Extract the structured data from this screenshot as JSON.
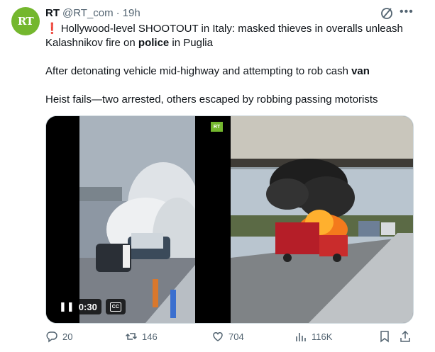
{
  "tweet": {
    "avatar_text": "RT",
    "name": "RT",
    "handle": "@RT_com",
    "separator": "·",
    "time": "19h",
    "line1_pre": "Hollywood-level SHOOTOUT in Italy: masked thieves in overalls unleash",
    "line2_pre": "Kalashnikov fire on ",
    "line2_bold": "police",
    "line2_post": " in Puglia",
    "line3_pre": "After detonating vehicle mid-highway and attempting to rob cash ",
    "line3_bold": "van",
    "line4": "Heist fails—two arrested, others escaped by robbing passing motorists"
  },
  "media": {
    "video_time": "0:30",
    "video_badge": "RT",
    "cc_label": "CC"
  },
  "actions": {
    "replies": "20",
    "reposts": "146",
    "likes": "704",
    "views": "116K"
  },
  "icons": [
    "grok-icon",
    "more-icon",
    "pause-icon",
    "captions-icon",
    "reply-icon",
    "repost-icon",
    "like-icon",
    "views-icon",
    "bookmark-icon",
    "share-icon"
  ],
  "colors": {
    "brand": "#74b72e",
    "muted": "#536471",
    "alert": "#e0245e"
  }
}
